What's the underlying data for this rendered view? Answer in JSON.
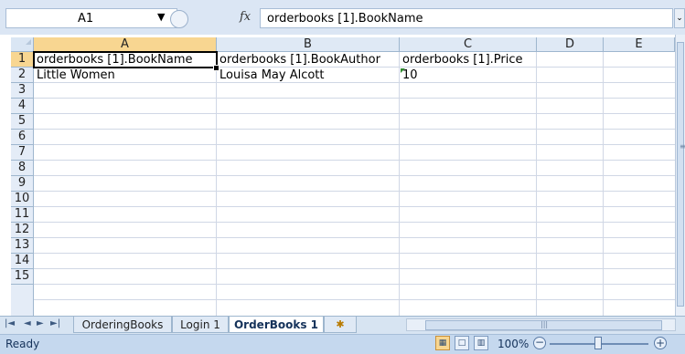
{
  "name_box": {
    "value": "A1"
  },
  "formula": {
    "fx_label": "fx",
    "value": "orderbooks [1].BookName"
  },
  "columns": [
    "A",
    "B",
    "C",
    "D",
    "E"
  ],
  "rows": [
    "1",
    "2",
    "3",
    "4",
    "5",
    "6",
    "7",
    "8",
    "9",
    "10",
    "11",
    "12",
    "13",
    "14",
    "15"
  ],
  "cells": {
    "A1": "orderbooks [1].BookName",
    "B1": "orderbooks [1].BookAuthor",
    "C1": "orderbooks [1].Price",
    "A2": "Little Women",
    "B2": "Louisa May Alcott",
    "C2": "10"
  },
  "sheet_tabs": [
    {
      "label": "OrderingBooks",
      "active": false
    },
    {
      "label": "Login 1",
      "active": false
    },
    {
      "label": "OrderBooks 1",
      "active": true
    }
  ],
  "status": {
    "text": "Ready",
    "zoom": "100%"
  },
  "icons": {
    "nav_first": "first-sheet-icon",
    "nav_prev": "prev-sheet-icon",
    "nav_next": "next-sheet-icon",
    "nav_last": "last-sheet-icon",
    "new_sheet": "new-sheet-icon"
  },
  "colors": {
    "selection": "#f8d691",
    "header": "#dfe9f5",
    "chrome": "#c5d8ee"
  }
}
